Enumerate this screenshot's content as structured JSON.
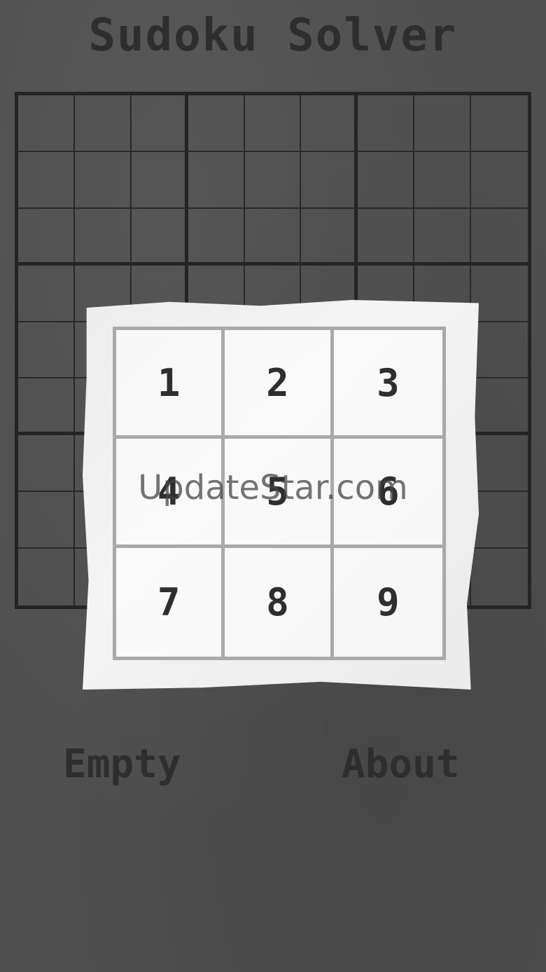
{
  "app": {
    "title": "Sudoku Solver"
  },
  "board": {
    "rows": 9,
    "cols": 9
  },
  "buttons": {
    "empty_label": "Empty",
    "about_label": "About"
  },
  "number_picker": {
    "numbers": [
      "1",
      "2",
      "3",
      "4",
      "5",
      "6",
      "7",
      "8",
      "9"
    ]
  },
  "watermark": {
    "text": "UpdateStar.com"
  },
  "colors": {
    "background": "#4f4f4f",
    "ink": "#2e2e2e",
    "paper": "#f4f4f4",
    "picker_grid": "#a9a9a9"
  }
}
